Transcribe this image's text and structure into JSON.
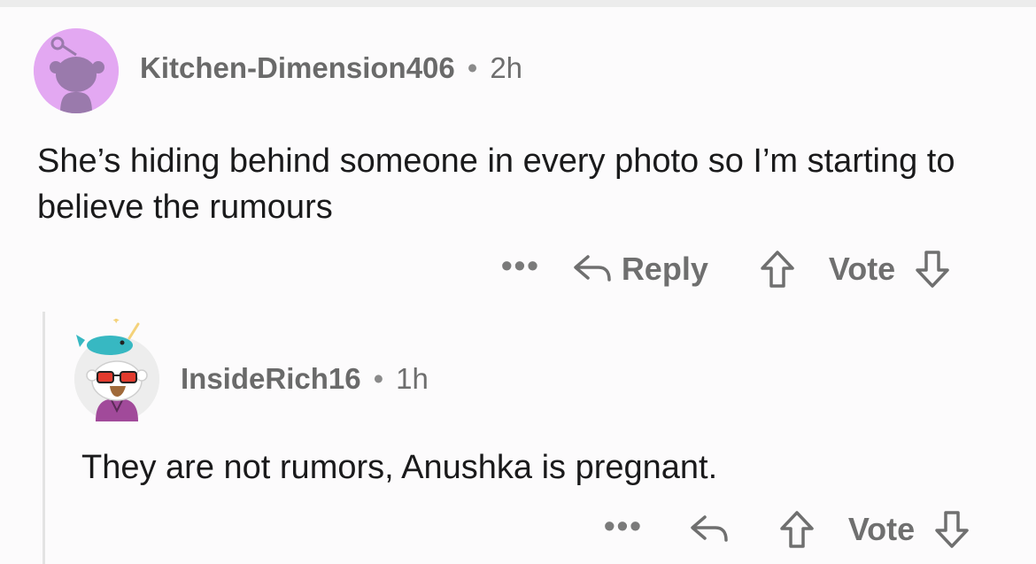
{
  "comments": [
    {
      "username": "Kitchen-Dimension406",
      "separator": "•",
      "time": "2h",
      "text": "She’s hiding behind someone in every photo so I’m starting to believe the rumours",
      "actions": {
        "more": "•••",
        "reply": "Reply",
        "vote": "Vote"
      },
      "avatar": {
        "icon": "snoo-avatar-icon",
        "background": "#e3a8f2",
        "figure": "#9a7aac"
      }
    },
    {
      "username": "InsideRich16",
      "separator": "•",
      "time": "1h",
      "text": "They are not rumors, Anushka is pregnant.",
      "actions": {
        "more": "•••",
        "vote": "Vote"
      },
      "avatar": {
        "icon": "snoo-sunglasses-narwhal-avatar-icon",
        "background": "#ededed"
      }
    }
  ],
  "colors": {
    "meta_text": "#6e6e6e",
    "body_text": "#1a1a1b",
    "action_text": "#6f6f6f",
    "thread_line": "#e3e3e3"
  }
}
